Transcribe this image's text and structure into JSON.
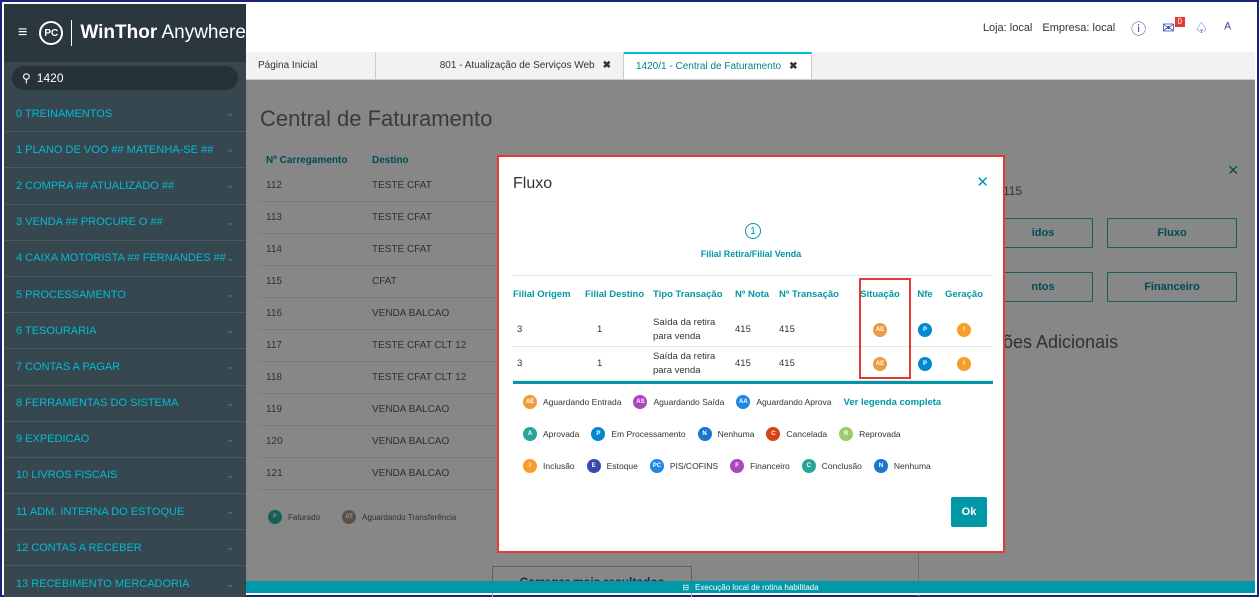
{
  "app": {
    "name_bold": "WinThor",
    "name_rest": " Anywhere",
    "logo": "PC"
  },
  "search": {
    "value": "1420"
  },
  "sidebar": {
    "items": [
      "0  TREINAMENTOS",
      "1  PLANO DE VOO ## MATENHA-SE ##",
      "2  COMPRA ## ATUALIZADO ##",
      "3  VENDA ## PROCURE O ##",
      "4  CAIXA MOTORISTA ## FERNANDES ##",
      "5  PROCESSAMENTO",
      "6  TESOURARIA",
      "7  CONTAS A PAGAR",
      "8  FERRAMENTAS DO SISTEMA",
      "9  EXPEDICAO",
      "10  LIVROS FISCAIS",
      "11  ADM. INTERNA DO ESTOQUE",
      "12  CONTAS A RECEBER",
      "13  RECEBIMENTO MERCADORIA"
    ]
  },
  "topbar": {
    "loja": "Loja: local",
    "empresa": "Empresa: local",
    "mail_count": "0"
  },
  "tabs": [
    {
      "label": "Página Inicial"
    },
    {
      "label": "801 - Atualização de Serviços Web"
    },
    {
      "label": "1420/1 - Central de Faturamento"
    }
  ],
  "page": {
    "title": "Central de Faturamento",
    "table_headers": [
      "Nº Carregamento",
      "Destino"
    ],
    "rows": [
      [
        "112",
        "TESTE CFAT"
      ],
      [
        "113",
        "TESTE CFAT"
      ],
      [
        "114",
        "TESTE CFAT"
      ],
      [
        "115",
        "CFAT"
      ],
      [
        "116",
        "VENDA BALCAO"
      ],
      [
        "117",
        "TESTE CFAT CLT 12"
      ],
      [
        "118",
        "TESTE CFAT CLT 12"
      ],
      [
        "119",
        "VENDA BALCAO"
      ],
      [
        "120",
        "VENDA BALCAO"
      ],
      [
        "121",
        "VENDA BALCAO"
      ]
    ],
    "legend": [
      {
        "code": "F",
        "label": "Faturado",
        "color": "#26a69a"
      },
      {
        "code": "AT",
        "label": "Aguardando Transferência",
        "color": "#a1887f"
      }
    ],
    "load_more": "Carregar mais resultados",
    "right_panel": {
      "num_suffix": "115",
      "btn_pedidos": "idos",
      "btn_fluxo": "Fluxo",
      "btn_itens": "ntos",
      "btn_financeiro": "Financeiro",
      "info": "ões Adicionais"
    },
    "status_bar": "Execução local de rotina habilitada"
  },
  "modal": {
    "title": "Fluxo",
    "step_number": "1",
    "step_label": "Filial Retira/Filial Venda",
    "headers": [
      "Filial Origem",
      "Filial Destino",
      "Tipo Transação",
      "Nº Nota",
      "Nº Transação",
      "Situação",
      "Nfe",
      "Geração"
    ],
    "rows": [
      {
        "origem": "3",
        "destino": "1",
        "tipo": "Saída da retira para venda",
        "nota": "415",
        "transacao": "415",
        "situacao": "AE",
        "nfe": "P",
        "geracao": "I"
      },
      {
        "origem": "3",
        "destino": "1",
        "tipo": "Saída da retira para venda",
        "nota": "415",
        "transacao": "415",
        "situacao": "AE",
        "nfe": "P",
        "geracao": "I"
      }
    ],
    "legend_row1": [
      {
        "code": "AE",
        "label": "Aguardando Entrada",
        "color": "#ef9a3c"
      },
      {
        "code": "AS",
        "label": "Aguardando Saída",
        "color": "#ab47bc"
      },
      {
        "code": "AA",
        "label": "Aguardando Aprova",
        "color": "#1e88e5"
      }
    ],
    "legend_link": "Ver legenda completa",
    "legend_row2": [
      {
        "code": "A",
        "label": "Aprovada",
        "color": "#26a69a"
      },
      {
        "code": "P",
        "label": "Em Processamento",
        "color": "#0288d1"
      },
      {
        "code": "N",
        "label": "Nenhuma",
        "color": "#1976d2"
      },
      {
        "code": "C",
        "label": "Cancelada",
        "color": "#d84315"
      },
      {
        "code": "R",
        "label": "Reprovada",
        "color": "#9ccc65"
      }
    ],
    "legend_row3": [
      {
        "code": "I",
        "label": "Inclusão",
        "color": "#f59e2a"
      },
      {
        "code": "E",
        "label": "Estoque",
        "color": "#3949ab"
      },
      {
        "code": "PC",
        "label": "PIS/COFINS",
        "color": "#1e88e5"
      },
      {
        "code": "F",
        "label": "Financeiro",
        "color": "#ab47bc"
      },
      {
        "code": "C",
        "label": "Conclusão",
        "color": "#26a69a"
      },
      {
        "code": "N",
        "label": "Nenhuma",
        "color": "#1976d2"
      }
    ],
    "ok_label": "Ok",
    "colors": {
      "situacao": "#ef9a3c",
      "nfe": "#0288d1",
      "geracao": "#f59e2a"
    }
  }
}
